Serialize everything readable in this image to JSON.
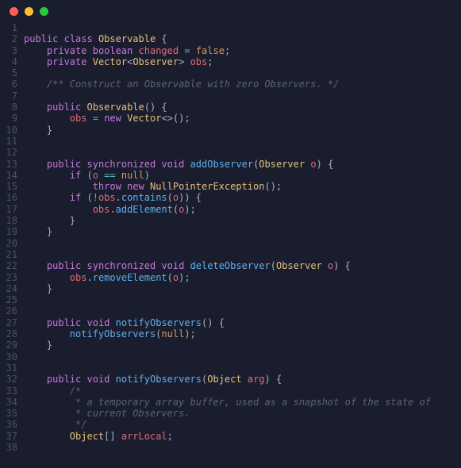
{
  "titlebar": {
    "dots": [
      "red",
      "yellow",
      "green"
    ]
  },
  "code_lines": [
    {
      "n": 1,
      "tokens": []
    },
    {
      "n": 2,
      "tokens": [
        [
          "k",
          "public"
        ],
        [
          "p",
          " "
        ],
        [
          "k",
          "class"
        ],
        [
          "p",
          " "
        ],
        [
          "t",
          "Observable"
        ],
        [
          "p",
          " {"
        ]
      ]
    },
    {
      "n": 3,
      "tokens": [
        [
          "p",
          "    "
        ],
        [
          "k",
          "private"
        ],
        [
          "p",
          " "
        ],
        [
          "k",
          "boolean"
        ],
        [
          "p",
          " "
        ],
        [
          "v",
          "changed"
        ],
        [
          "p",
          " "
        ],
        [
          "o",
          "="
        ],
        [
          "p",
          " "
        ],
        [
          "b",
          "false"
        ],
        [
          "p",
          ";"
        ]
      ]
    },
    {
      "n": 4,
      "tokens": [
        [
          "p",
          "    "
        ],
        [
          "k",
          "private"
        ],
        [
          "p",
          " "
        ],
        [
          "t",
          "Vector"
        ],
        [
          "p",
          "<"
        ],
        [
          "t",
          "Observer"
        ],
        [
          "p",
          "> "
        ],
        [
          "v",
          "obs"
        ],
        [
          "p",
          ";"
        ]
      ]
    },
    {
      "n": 5,
      "tokens": []
    },
    {
      "n": 6,
      "tokens": [
        [
          "p",
          "    "
        ],
        [
          "c",
          "/** Construct an Observable with zero Observers. */"
        ]
      ]
    },
    {
      "n": 7,
      "tokens": []
    },
    {
      "n": 8,
      "tokens": [
        [
          "p",
          "    "
        ],
        [
          "k",
          "public"
        ],
        [
          "p",
          " "
        ],
        [
          "t",
          "Observable"
        ],
        [
          "p",
          "() {"
        ]
      ]
    },
    {
      "n": 9,
      "tokens": [
        [
          "p",
          "        "
        ],
        [
          "v",
          "obs"
        ],
        [
          "p",
          " "
        ],
        [
          "o",
          "="
        ],
        [
          "p",
          " "
        ],
        [
          "k",
          "new"
        ],
        [
          "p",
          " "
        ],
        [
          "t",
          "Vector"
        ],
        [
          "p",
          "<>();"
        ]
      ]
    },
    {
      "n": 10,
      "tokens": [
        [
          "p",
          "    }"
        ]
      ]
    },
    {
      "n": 11,
      "tokens": []
    },
    {
      "n": 12,
      "tokens": []
    },
    {
      "n": 13,
      "tokens": [
        [
          "p",
          "    "
        ],
        [
          "k",
          "public"
        ],
        [
          "p",
          " "
        ],
        [
          "k",
          "synchronized"
        ],
        [
          "p",
          " "
        ],
        [
          "k",
          "void"
        ],
        [
          "p",
          " "
        ],
        [
          "m",
          "addObserver"
        ],
        [
          "p",
          "("
        ],
        [
          "t",
          "Observer"
        ],
        [
          "p",
          " "
        ],
        [
          "v",
          "o"
        ],
        [
          "p",
          ") {"
        ]
      ]
    },
    {
      "n": 14,
      "tokens": [
        [
          "p",
          "        "
        ],
        [
          "k",
          "if"
        ],
        [
          "p",
          " ("
        ],
        [
          "v",
          "o"
        ],
        [
          "p",
          " "
        ],
        [
          "o",
          "=="
        ],
        [
          "p",
          " "
        ],
        [
          "b",
          "null"
        ],
        [
          "p",
          ")"
        ]
      ]
    },
    {
      "n": 15,
      "tokens": [
        [
          "p",
          "            "
        ],
        [
          "k",
          "throw"
        ],
        [
          "p",
          " "
        ],
        [
          "k",
          "new"
        ],
        [
          "p",
          " "
        ],
        [
          "t",
          "NullPointerException"
        ],
        [
          "p",
          "();"
        ]
      ]
    },
    {
      "n": 16,
      "tokens": [
        [
          "p",
          "        "
        ],
        [
          "k",
          "if"
        ],
        [
          "p",
          " ("
        ],
        [
          "o",
          "!"
        ],
        [
          "v",
          "obs"
        ],
        [
          "p",
          "."
        ],
        [
          "m",
          "contains"
        ],
        [
          "p",
          "("
        ],
        [
          "v",
          "o"
        ],
        [
          "p",
          ")) {"
        ]
      ]
    },
    {
      "n": 17,
      "tokens": [
        [
          "p",
          "            "
        ],
        [
          "v",
          "obs"
        ],
        [
          "p",
          "."
        ],
        [
          "m",
          "addElement"
        ],
        [
          "p",
          "("
        ],
        [
          "v",
          "o"
        ],
        [
          "p",
          ");"
        ]
      ]
    },
    {
      "n": 18,
      "tokens": [
        [
          "p",
          "        }"
        ]
      ]
    },
    {
      "n": 19,
      "tokens": [
        [
          "p",
          "    }"
        ]
      ]
    },
    {
      "n": 20,
      "tokens": []
    },
    {
      "n": 21,
      "tokens": []
    },
    {
      "n": 22,
      "tokens": [
        [
          "p",
          "    "
        ],
        [
          "k",
          "public"
        ],
        [
          "p",
          " "
        ],
        [
          "k",
          "synchronized"
        ],
        [
          "p",
          " "
        ],
        [
          "k",
          "void"
        ],
        [
          "p",
          " "
        ],
        [
          "m",
          "deleteObserver"
        ],
        [
          "p",
          "("
        ],
        [
          "t",
          "Observer"
        ],
        [
          "p",
          " "
        ],
        [
          "v",
          "o"
        ],
        [
          "p",
          ") {"
        ]
      ]
    },
    {
      "n": 23,
      "tokens": [
        [
          "p",
          "        "
        ],
        [
          "v",
          "obs"
        ],
        [
          "p",
          "."
        ],
        [
          "m",
          "removeElement"
        ],
        [
          "p",
          "("
        ],
        [
          "v",
          "o"
        ],
        [
          "p",
          ");"
        ]
      ]
    },
    {
      "n": 24,
      "tokens": [
        [
          "p",
          "    }"
        ]
      ]
    },
    {
      "n": 25,
      "tokens": []
    },
    {
      "n": 26,
      "tokens": []
    },
    {
      "n": 27,
      "tokens": [
        [
          "p",
          "    "
        ],
        [
          "k",
          "public"
        ],
        [
          "p",
          " "
        ],
        [
          "k",
          "void"
        ],
        [
          "p",
          " "
        ],
        [
          "m",
          "notifyObservers"
        ],
        [
          "p",
          "() {"
        ]
      ]
    },
    {
      "n": 28,
      "tokens": [
        [
          "p",
          "        "
        ],
        [
          "m",
          "notifyObservers"
        ],
        [
          "p",
          "("
        ],
        [
          "b",
          "null"
        ],
        [
          "p",
          ");"
        ]
      ]
    },
    {
      "n": 29,
      "tokens": [
        [
          "p",
          "    }"
        ]
      ]
    },
    {
      "n": 30,
      "tokens": []
    },
    {
      "n": 31,
      "tokens": []
    },
    {
      "n": 32,
      "tokens": [
        [
          "p",
          "    "
        ],
        [
          "k",
          "public"
        ],
        [
          "p",
          " "
        ],
        [
          "k",
          "void"
        ],
        [
          "p",
          " "
        ],
        [
          "m",
          "notifyObservers"
        ],
        [
          "p",
          "("
        ],
        [
          "t",
          "Object"
        ],
        [
          "p",
          " "
        ],
        [
          "v",
          "arg"
        ],
        [
          "p",
          ") {"
        ]
      ]
    },
    {
      "n": 33,
      "tokens": [
        [
          "p",
          "        "
        ],
        [
          "c",
          "/*"
        ]
      ]
    },
    {
      "n": 34,
      "tokens": [
        [
          "p",
          "         "
        ],
        [
          "c",
          "* a temporary array buffer, used as a snapshot of the state of"
        ]
      ]
    },
    {
      "n": 35,
      "tokens": [
        [
          "p",
          "         "
        ],
        [
          "c",
          "* current Observers."
        ]
      ]
    },
    {
      "n": 36,
      "tokens": [
        [
          "p",
          "         "
        ],
        [
          "c",
          "*/"
        ]
      ]
    },
    {
      "n": 37,
      "tokens": [
        [
          "p",
          "        "
        ],
        [
          "t",
          "Object"
        ],
        [
          "p",
          "[] "
        ],
        [
          "v",
          "arrLocal"
        ],
        [
          "p",
          ";"
        ]
      ]
    },
    {
      "n": 38,
      "tokens": []
    }
  ]
}
